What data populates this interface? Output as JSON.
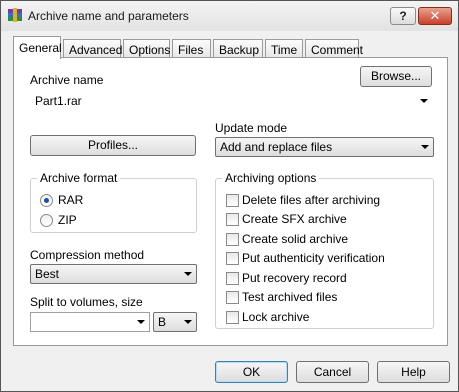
{
  "window": {
    "title": "Archive name and parameters",
    "help_label": "?",
    "close_label": "✕"
  },
  "tabs": [
    {
      "label": "General",
      "active": true
    },
    {
      "label": "Advanced"
    },
    {
      "label": "Options"
    },
    {
      "label": "Files"
    },
    {
      "label": "Backup"
    },
    {
      "label": "Time"
    },
    {
      "label": "Comment"
    }
  ],
  "archive_name": {
    "label": "Archive name",
    "browse_label": "Browse...",
    "value": "Part1.rar"
  },
  "profiles_label": "Profiles...",
  "update_mode": {
    "label": "Update mode",
    "value": "Add and replace files"
  },
  "archive_format": {
    "title": "Archive format",
    "options": [
      "RAR",
      "ZIP"
    ],
    "selected": "RAR"
  },
  "archiving_options": {
    "title": "Archiving options",
    "items": [
      "Delete files after archiving",
      "Create SFX archive",
      "Create solid archive",
      "Put authenticity verification",
      "Put recovery record",
      "Test archived files",
      "Lock archive"
    ]
  },
  "compression": {
    "label": "Compression method",
    "value": "Best"
  },
  "split": {
    "label": "Split to volumes, size",
    "value": "",
    "unit": "B"
  },
  "footer": {
    "ok": "OK",
    "cancel": "Cancel",
    "help": "Help"
  }
}
